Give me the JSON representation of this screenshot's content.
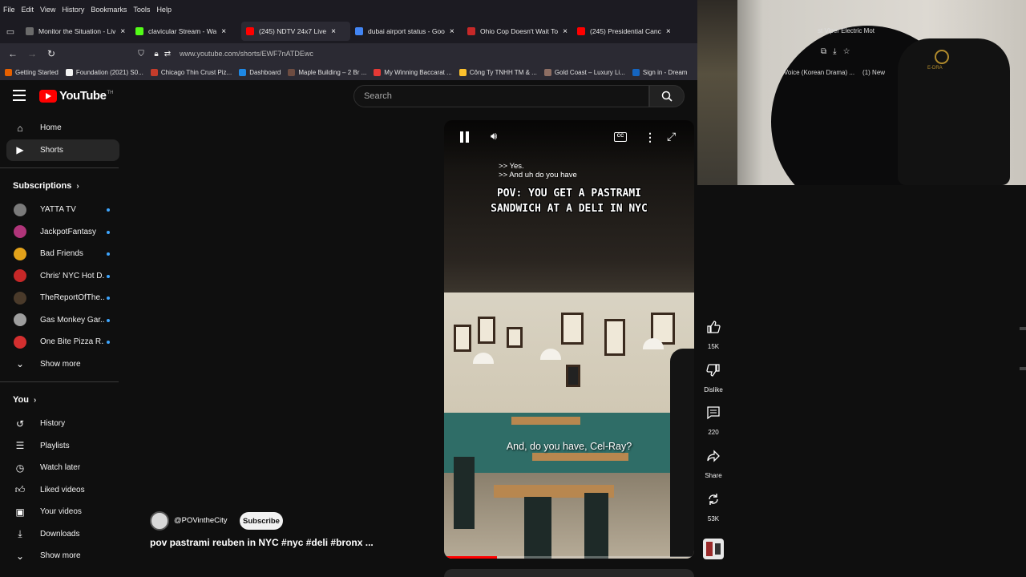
{
  "menubar": [
    "File",
    "Edit",
    "View",
    "History",
    "Bookmarks",
    "Tools",
    "Help"
  ],
  "tabs": [
    {
      "label": "Monitor the Situation - Liv",
      "color": "#6b6b6b",
      "active": false
    },
    {
      "label": "clavicular Stream - Wa",
      "color": "#53fc18",
      "active": false
    },
    {
      "label": "(245) NDTV 24x7 Live",
      "color": "#ff0000",
      "active": true
    },
    {
      "label": "dubai airport status - Goo",
      "color": "#4285f4",
      "active": false
    },
    {
      "label": "Ohio Cop Doesn't Wait To",
      "color": "#c62828",
      "active": false
    },
    {
      "label": "(245) Presidential Canc",
      "color": "#ff0000",
      "active": false
    }
  ],
  "address": {
    "url": "www.youtube.com/shorts/EWF7nATDEwc"
  },
  "bookmarks": [
    {
      "label": "Getting Started",
      "color": "#e66000"
    },
    {
      "label": "Foundation (2021) S0...",
      "color": "#f2f2f2"
    },
    {
      "label": "Chicago Thin Crust Piz...",
      "color": "#c43c2b"
    },
    {
      "label": "Dashboard",
      "color": "#1e88e5"
    },
    {
      "label": "Maple Building – 2 Br ...",
      "color": "#6d4c41"
    },
    {
      "label": "My Winning Baccarat ...",
      "color": "#e53935"
    },
    {
      "label": "Công Ty TNHH TM & ...",
      "color": "#fbc02d"
    },
    {
      "label": "Gold Coast – Luxury Li...",
      "color": "#8d6e63"
    },
    {
      "label": "Sign in - Dream",
      "color": "#1565c0"
    }
  ],
  "header": {
    "logo": "YouTube",
    "tm": "TH",
    "search_placeholder": "Search"
  },
  "sidebar": {
    "main": [
      {
        "label": "Home",
        "icon": "home-icon",
        "active": false
      },
      {
        "label": "Shorts",
        "icon": "shorts-icon",
        "active": true
      }
    ],
    "subscriptions_title": "Subscriptions",
    "subscriptions": [
      {
        "label": "YATTA TV",
        "color": "#7a7a7a"
      },
      {
        "label": "JackpotFantasy",
        "color": "#b0357a"
      },
      {
        "label": "Bad Friends",
        "color": "#e3a21a"
      },
      {
        "label": "Chris' NYC Hot D...",
        "color": "#c62828"
      },
      {
        "label": "TheReportOfThe...",
        "color": "#4a3a2a"
      },
      {
        "label": "Gas Monkey Gar...",
        "color": "#9e9e9e"
      },
      {
        "label": "One Bite Pizza R...",
        "color": "#d32f2f"
      }
    ],
    "show_more_1": "Show more",
    "you_title": "You",
    "you_items": [
      {
        "label": "History",
        "icon": "history-icon"
      },
      {
        "label": "Playlists",
        "icon": "playlists-icon"
      },
      {
        "label": "Watch later",
        "icon": "watch-later-icon"
      },
      {
        "label": "Liked videos",
        "icon": "liked-videos-icon"
      },
      {
        "label": "Your videos",
        "icon": "your-videos-icon"
      },
      {
        "label": "Downloads",
        "icon": "downloads-icon"
      }
    ],
    "show_more_2": "Show more"
  },
  "video": {
    "caption_top_1": ">> Yes.",
    "caption_top_2": ">> And uh do you have",
    "title_overlay_1": "POV: YOU GET A PASTRAMI",
    "title_overlay_2": "SANDWICH AT A DELI IN NYC",
    "caption_bottom": "And, do you have, Cel-Ray?",
    "progress": 0.21
  },
  "channel": {
    "name": "@POVintheCity",
    "subscribe_label": "Subscribe"
  },
  "video_title": "pov pastrami reuben in NYC #nyc #deli #bronx ...",
  "actions": {
    "like_count": "15K",
    "dislike_label": "Dislike",
    "comment_count": "220",
    "share_label": "Share",
    "remix_count": "53K"
  },
  "webcam_overlay": {
    "url_fragment": "st Viper Electric Mot",
    "bookmark_1": "Voice (Korean Drama) ...",
    "bookmark_2": "(1) New",
    "chair_brand": "E-DRA"
  }
}
